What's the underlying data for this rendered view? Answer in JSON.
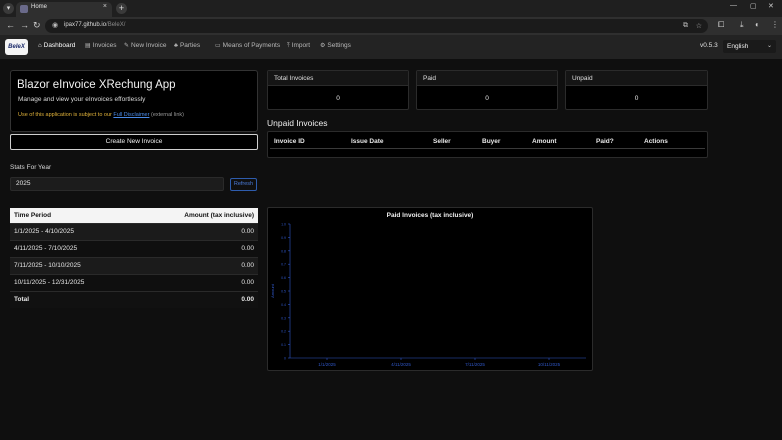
{
  "browser": {
    "tab_title": "Home",
    "url_host": "ipax77.github.io",
    "url_path": "/BeleX/"
  },
  "app": {
    "logo_text": "BeleX",
    "nav": [
      {
        "label": "Dashboard",
        "icon": "home-icon",
        "active": true
      },
      {
        "label": "Invoices",
        "icon": "document-icon",
        "active": false
      },
      {
        "label": "New Invoice",
        "icon": "edit-icon",
        "active": false
      },
      {
        "label": "Parties",
        "icon": "people-icon",
        "active": false
      },
      {
        "label": "Means of Payments",
        "icon": "card-icon",
        "active": false
      },
      {
        "label": "Import",
        "icon": "upload-icon",
        "active": false
      },
      {
        "label": "Settings",
        "icon": "gear-icon",
        "active": false
      }
    ],
    "version": "v0.5.3",
    "language": "English"
  },
  "intro": {
    "title": "Blazor eInvoice XRechung App",
    "subtitle": "Manage and view your eInvoices effortlessly",
    "note_prefix": "Use of this application is subject to our",
    "note_link": "Full Disclaimer",
    "note_suffix": "(external link)"
  },
  "create_button": "Create New Invoice",
  "stats": {
    "label": "Stats For Year",
    "year": "2025",
    "refresh_label": "Refresh"
  },
  "period_table": {
    "headers": [
      "Time Period",
      "Amount (tax inclusive)"
    ],
    "rows": [
      {
        "period": "1/1/2025 - 4/10/2025",
        "amount": "0.00"
      },
      {
        "period": "4/11/2025 - 7/10/2025",
        "amount": "0.00"
      },
      {
        "period": "7/11/2025 - 10/10/2025",
        "amount": "0.00"
      },
      {
        "period": "10/11/2025 - 12/31/2025",
        "amount": "0.00"
      }
    ],
    "total_label": "Total",
    "total_amount": "0.00"
  },
  "summary": [
    {
      "label": "Total Invoices",
      "value": "0"
    },
    {
      "label": "Paid",
      "value": "0"
    },
    {
      "label": "Unpaid",
      "value": "0"
    }
  ],
  "unpaid": {
    "heading": "Unpaid Invoices",
    "columns": [
      "Invoice ID",
      "Issue Date",
      "Seller",
      "Buyer",
      "Amount",
      "Paid?",
      "Actions"
    ]
  },
  "chart_data": {
    "type": "bar",
    "title": "Paid Invoices (tax inclusive)",
    "ylabel": "Amount",
    "categories": [
      "1/1/2025",
      "4/11/2025",
      "7/11/2025",
      "10/11/2025"
    ],
    "values": [
      0,
      0,
      0,
      0
    ],
    "ylim": [
      0,
      1
    ],
    "yticks": [
      "0",
      "0.1",
      "0.2",
      "0.3",
      "0.4",
      "0.5",
      "0.6",
      "0.7",
      "0.8",
      "0.9",
      "1.0"
    ],
    "grid": false,
    "axis_color": "#2f57c9"
  }
}
